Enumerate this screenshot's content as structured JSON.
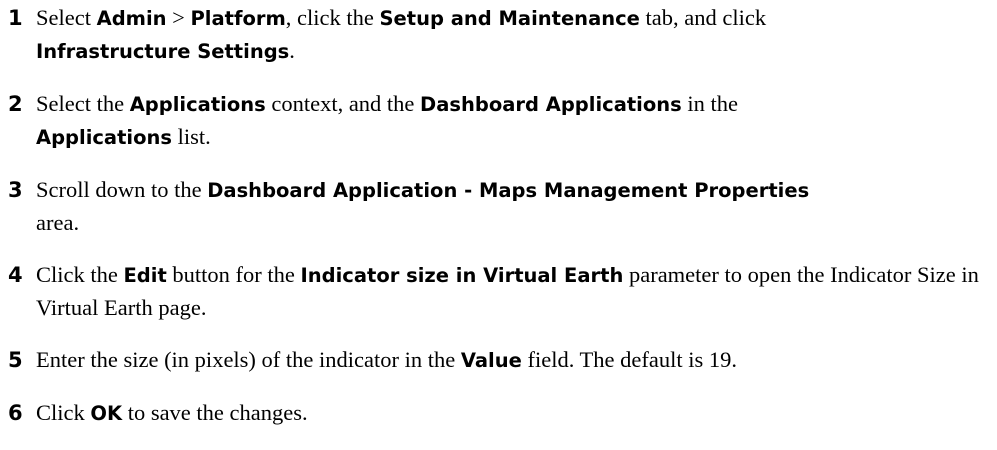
{
  "steps": [
    {
      "number": "1",
      "parts": [
        {
          "t": "Select ",
          "b": false
        },
        {
          "t": "Admin",
          "b": true
        },
        {
          "t": " > ",
          "b": false
        },
        {
          "t": "Platform",
          "b": true
        },
        {
          "t": ", click the ",
          "b": false
        },
        {
          "t": "Setup and Maintenance",
          "b": true
        },
        {
          "t": " tab, and click ",
          "b": false
        },
        {
          "t": "Infrastructure Settings",
          "b": true
        },
        {
          "t": ".",
          "b": false
        }
      ]
    },
    {
      "number": "2",
      "parts": [
        {
          "t": "Select the ",
          "b": false
        },
        {
          "t": "Applications",
          "b": true
        },
        {
          "t": " context, and the ",
          "b": false
        },
        {
          "t": "Dashboard Applications",
          "b": true
        },
        {
          "t": " in the ",
          "b": false
        },
        {
          "t": "Applications",
          "b": true
        },
        {
          "t": " list.",
          "b": false
        }
      ]
    },
    {
      "number": "3",
      "parts": [
        {
          "t": "Scroll down to the ",
          "b": false
        },
        {
          "t": "Dashboard Application - Maps Management Properties",
          "b": true
        },
        {
          "t": " area.",
          "b": false
        }
      ]
    },
    {
      "number": "4",
      "parts": [
        {
          "t": "Click the ",
          "b": false
        },
        {
          "t": "Edit",
          "b": true
        },
        {
          "t": " button for the ",
          "b": false
        },
        {
          "t": "Indicator size in Virtual Earth",
          "b": true
        },
        {
          "t": " parameter to open the Indicator Size in Virtual Earth page.",
          "b": false
        }
      ]
    },
    {
      "number": "5",
      "parts": [
        {
          "t": "Enter the size (in pixels) of the indicator in the ",
          "b": false
        },
        {
          "t": "Value",
          "b": true
        },
        {
          "t": " field. The default is 19.",
          "b": false
        }
      ]
    },
    {
      "number": "6",
      "parts": [
        {
          "t": "Click ",
          "b": false
        },
        {
          "t": "OK",
          "b": true
        },
        {
          "t": " to save the changes.",
          "b": false
        }
      ]
    }
  ]
}
